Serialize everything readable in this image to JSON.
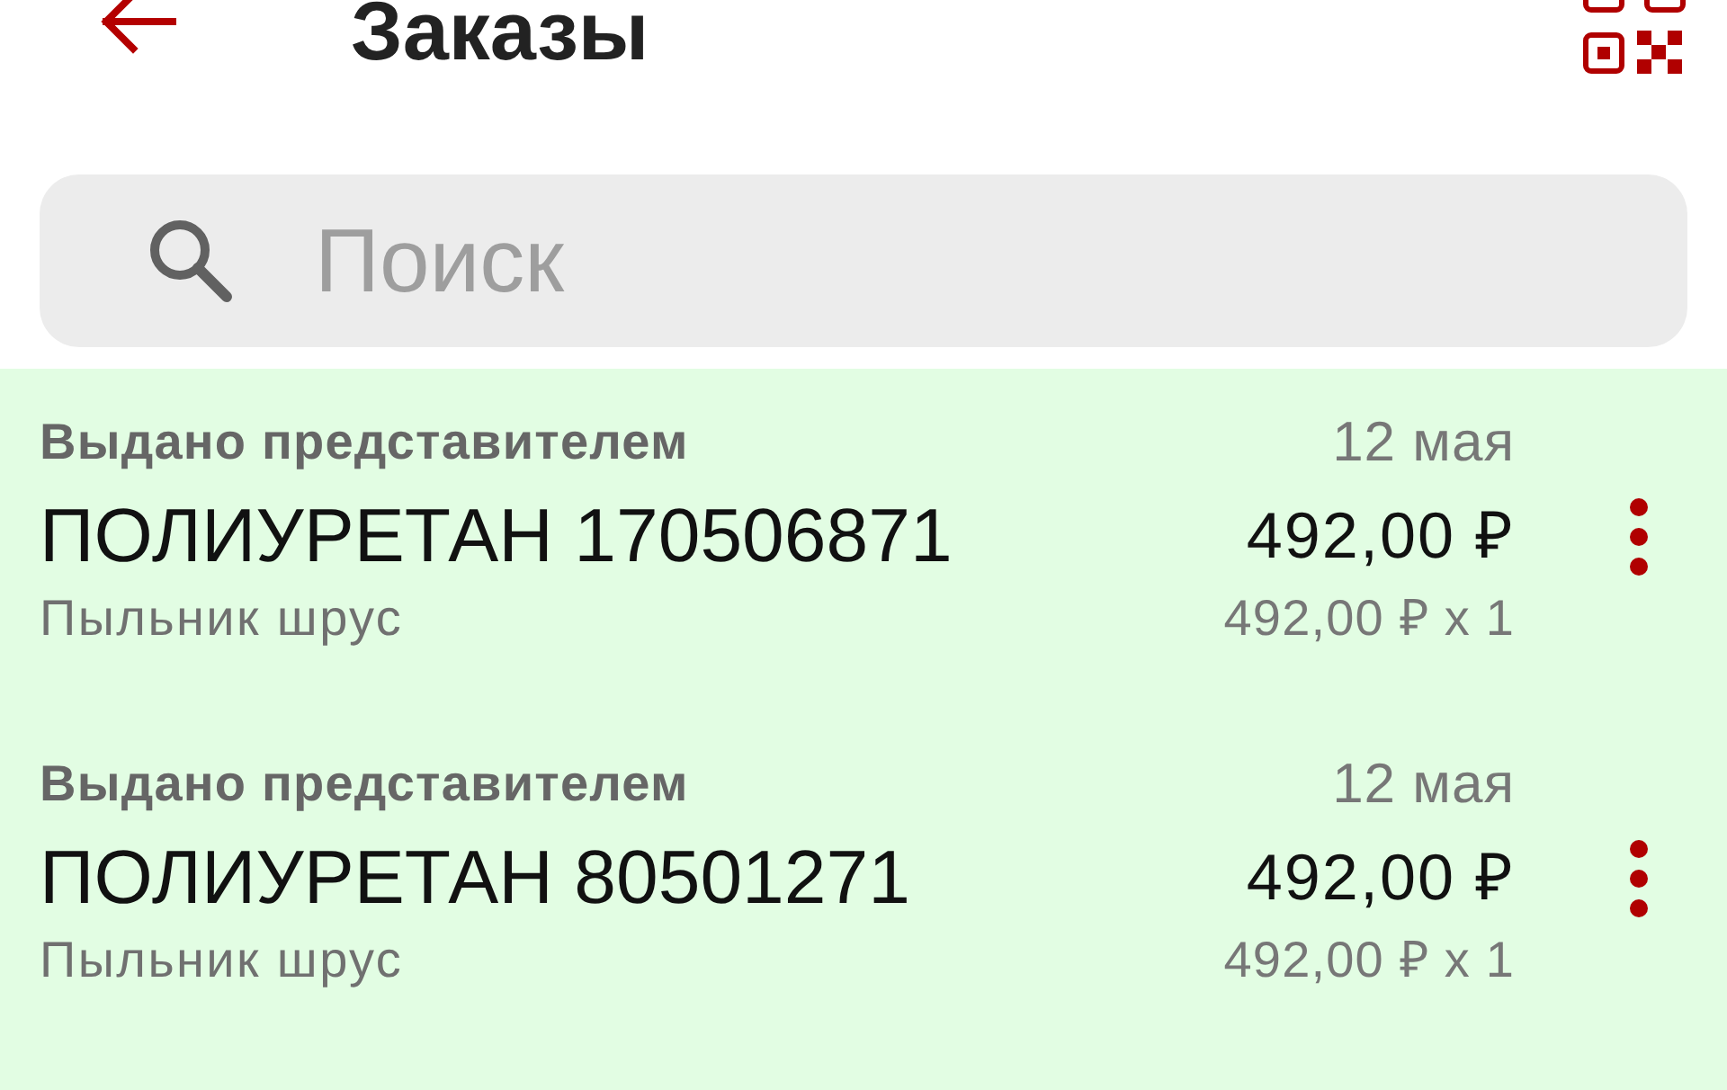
{
  "header": {
    "title": "Заказы"
  },
  "search": {
    "placeholder": "Поиск"
  },
  "orders": [
    {
      "status": "Выдано представителем",
      "date": "12 мая",
      "title": "ПОЛИУРЕТАН 170506871",
      "price": "492,00 ₽",
      "description": "Пыльник шрус",
      "unit_price": "492,00 ₽ x 1"
    },
    {
      "status": "Выдано представителем",
      "date": "12 мая",
      "title": "ПОЛИУРЕТАН 80501271",
      "price": "492,00 ₽",
      "description": "Пыльник шрус",
      "unit_price": "492,00 ₽ x 1"
    }
  ]
}
